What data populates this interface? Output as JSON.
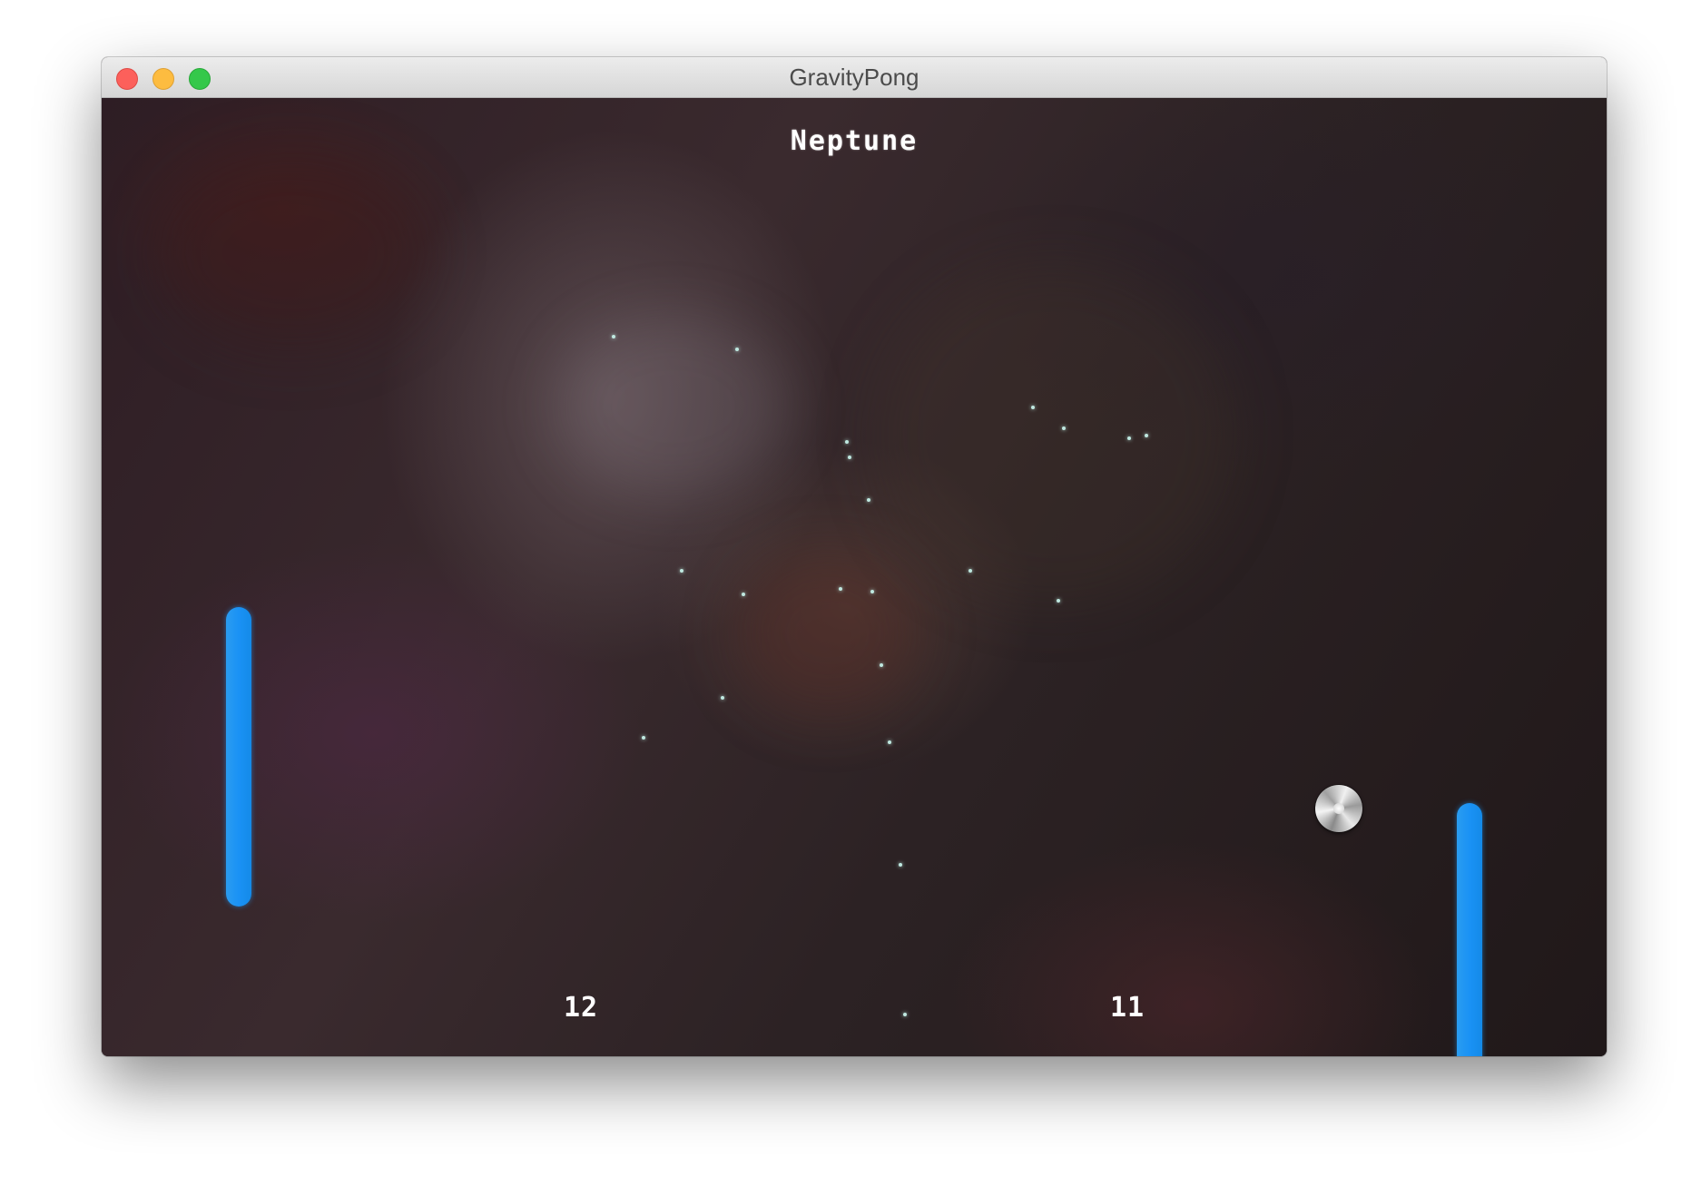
{
  "window": {
    "title": "GravityPong",
    "buttons": [
      "close",
      "minimize",
      "zoom"
    ]
  },
  "game": {
    "level_name": "Neptune",
    "scores": {
      "left": "12",
      "right": "11"
    },
    "paddle_color": "#1a92f5",
    "ball_icon": "metal-ball-icon"
  }
}
